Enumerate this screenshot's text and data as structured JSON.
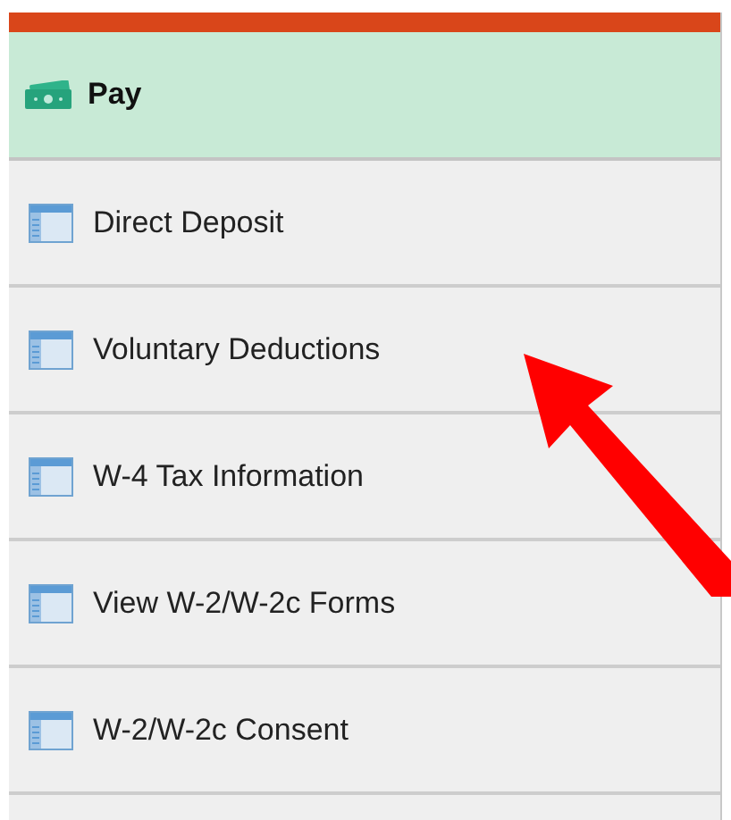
{
  "header": {
    "label": "Pay"
  },
  "items": [
    {
      "label": "Direct Deposit"
    },
    {
      "label": "Voluntary Deductions"
    },
    {
      "label": "W-4 Tax Information"
    },
    {
      "label": "View W-2/W-2c Forms"
    },
    {
      "label": "W-2/W-2c Consent"
    }
  ]
}
